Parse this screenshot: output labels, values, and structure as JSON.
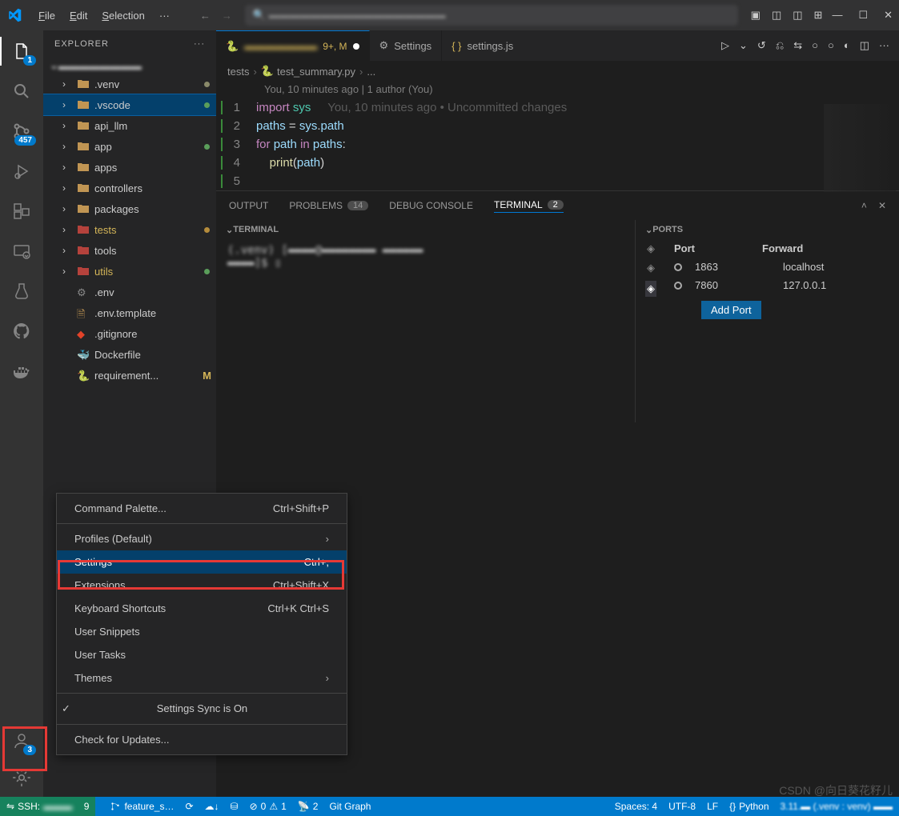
{
  "menu": {
    "file": "File",
    "edit": "Edit",
    "selection": "Selection",
    "more": "···"
  },
  "search_placeholder": "",
  "activity": {
    "explorer_badge": "1",
    "scm_badge": "457",
    "accounts_badge": "3"
  },
  "sidebar": {
    "title": "EXPLORER",
    "root": "▬▬▬▬▬▬▬▬",
    "items": [
      {
        "name": ".venv",
        "type": "folder",
        "dot": "#8a8a6a"
      },
      {
        "name": ".vscode",
        "type": "folder",
        "dot": "#5a9e5a",
        "selected": true
      },
      {
        "name": "api_llm",
        "type": "folder",
        "dot": ""
      },
      {
        "name": "app",
        "type": "folder",
        "dot": "#5a9e5a"
      },
      {
        "name": "apps",
        "type": "folder",
        "dot": ""
      },
      {
        "name": "controllers",
        "type": "folder",
        "dot": ""
      },
      {
        "name": "packages",
        "type": "folder",
        "dot": ""
      },
      {
        "name": "tests",
        "type": "folder",
        "dot": "#b58c3c",
        "warn": true,
        "iconColor": "#b5423c"
      },
      {
        "name": "tools",
        "type": "folder",
        "dot": "",
        "iconColor": "#b5423c"
      },
      {
        "name": "utils",
        "type": "folder",
        "dot": "#5a9e5a",
        "warn": true,
        "iconColor": "#b5423c"
      },
      {
        "name": ".env",
        "type": "file",
        "icon": "gear"
      },
      {
        "name": ".env.template",
        "type": "file",
        "icon": "env"
      },
      {
        "name": ".gitignore",
        "type": "file",
        "icon": "git"
      },
      {
        "name": "Dockerfile",
        "type": "file",
        "icon": "docker"
      },
      {
        "name": "requirement...",
        "type": "file",
        "icon": "python",
        "mod": "M"
      }
    ]
  },
  "tabs": [
    {
      "label": "▬▬▬▬▬▬▬",
      "icon": "python",
      "active": true,
      "suffix": "9+, M",
      "modified": true
    },
    {
      "label": "Settings",
      "icon": "gear"
    },
    {
      "label": "settings.js",
      "icon": "json",
      "runactions": true
    }
  ],
  "breadcrumb": {
    "p1": "tests",
    "p2": "test_summary.py",
    "p3": "..."
  },
  "blame": "You, 10 minutes ago | 1 author (You)",
  "inline_blame": "You, 10 minutes ago • Uncommitted changes",
  "code_lines": [
    {
      "n": "1",
      "html": "<span class='kw'>import</span> <span class='mod2'>sys</span>"
    },
    {
      "n": "2",
      "html": "<span class='var'>paths</span> <span class='pun'>=</span> <span class='var'>sys</span><span class='pun'>.</span><span class='var'>path</span>"
    },
    {
      "n": "3",
      "html": "<span class='kw'>for</span> <span class='var'>path</span> <span class='kw'>in</span> <span class='var'>paths</span><span class='pun'>:</span>"
    },
    {
      "n": "4",
      "html": "    <span class='fn'>print</span><span class='pun'>(</span><span class='var'>path</span><span class='pun'>)</span>"
    },
    {
      "n": "5",
      "html": ""
    }
  ],
  "panel": {
    "tabs": {
      "output": "OUTPUT",
      "problems": "PROBLEMS",
      "problems_count": "14",
      "debug": "DEBUG CONSOLE",
      "terminal": "TERMINAL",
      "terminal_count": "2"
    },
    "terminal_header": "TERMINAL",
    "terminal_text": "(.venv) [▬▬▬▬@▬▬▬▬▬▬▬▬ ▬▬▬▬▬▬\n▬▬▬▬]$ ▯",
    "ports_header": "PORTS",
    "ports": {
      "col1": "Port",
      "col2": "Forward",
      "rows": [
        {
          "port": "1863",
          "fwd": "localhost"
        },
        {
          "port": "7860",
          "fwd": "127.0.0.1"
        }
      ],
      "add": "Add Port"
    }
  },
  "context_menu": [
    {
      "label": "Command Palette...",
      "shortcut": "Ctrl+Shift+P"
    },
    {
      "sep": true
    },
    {
      "label": "Profiles (Default)",
      "chev": true
    },
    {
      "label": "Settings",
      "shortcut": "Ctrl+,",
      "highlighted": true
    },
    {
      "label": "Extensions",
      "shortcut": "Ctrl+Shift+X"
    },
    {
      "label": "Keyboard Shortcuts",
      "shortcut": "Ctrl+K Ctrl+S"
    },
    {
      "label": "User Snippets"
    },
    {
      "label": "User Tasks"
    },
    {
      "label": "Themes",
      "chev": true
    },
    {
      "sep": true
    },
    {
      "label": "Settings Sync is On",
      "check": true
    },
    {
      "sep": true
    },
    {
      "label": "Check for Updates..."
    }
  ],
  "statusbar": {
    "remote": "SSH:",
    "remote_blur": "▬▬▬",
    "remote_count": "9",
    "branch": "feature_s…",
    "sync": "",
    "errors": "0",
    "warnings": "1",
    "radio": "2",
    "gitgraph": "Git Graph",
    "spaces": "Spaces: 4",
    "encoding": "UTF-8",
    "eol": "LF",
    "lang": "Python",
    "pyver": "3.11.▬ (.venv : venv) ▬▬"
  },
  "watermark": "CSDN @向日葵花籽儿"
}
